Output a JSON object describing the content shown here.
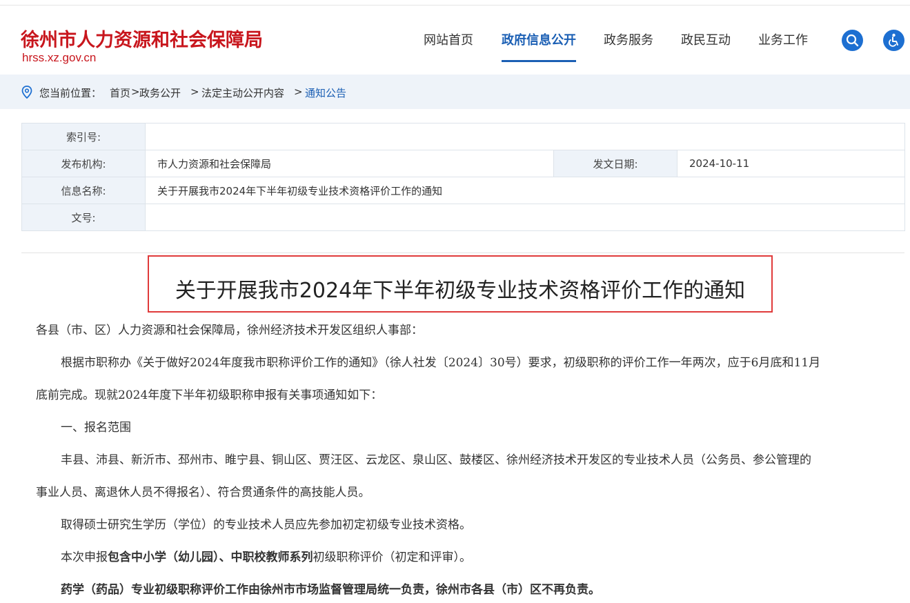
{
  "site": {
    "title": "徐州市人力资源和社会保障局",
    "url": "hrss.xz.gov.cn"
  },
  "nav": {
    "items": [
      {
        "label": "网站首页"
      },
      {
        "label": "政府信息公开",
        "active": true
      },
      {
        "label": "政务服务"
      },
      {
        "label": "政民互动"
      },
      {
        "label": "业务工作"
      }
    ],
    "search_icon": "search-icon",
    "accessibility_icon": "accessibility-icon"
  },
  "breadcrumb": {
    "prefix": "您当前位置：",
    "home": "首页",
    "sep1": ">",
    "level1": "政务公开",
    "sep2": ">",
    "level2": "法定主动公开内容",
    "sep3": ">",
    "current": "通知公告"
  },
  "info": {
    "index_label": "索引号:",
    "index_value": "",
    "publisher_label": "发布机构:",
    "publisher_value": "市人力资源和社会保障局",
    "date_label": "发文日期:",
    "date_value": "2024-10-11",
    "name_label": "信息名称:",
    "name_value": "关于开展我市2024年下半年初级专业技术资格评价工作的通知",
    "docno_label": "文号:",
    "docno_value": ""
  },
  "article": {
    "title": "关于开展我市2024年下半年初级专业技术资格评价工作的通知",
    "salutation": "各县（市、区）人力资源和社会保障局，徐州经济技术开发区组织人事部：",
    "p1_line1": "根据市职称办《关于做好2024年度我市职称评价工作的通知》（徐人社发〔2024〕30号）要求，初级职称的评价工作一年两次，应于6月底和11月",
    "p1_line2": "底前完成。现就2024年度下半年初级职称申报有关事项通知如下：",
    "section1": "一、报名范围",
    "p2_line1": "丰县、沛县、新沂市、邳州市、睢宁县、铜山区、贾汪区、云龙区、泉山区、鼓楼区、徐州经济技术开发区的专业技术人员（公务员、参公管理的",
    "p2_line2": "事业人员、离退休人员不得报名）、符合贯通条件的高技能人员。",
    "p3": "取得硕士研究生学历（学位）的专业技术人员应先参加初定初级专业技术资格。",
    "p4_pre": "本次申报",
    "p4_bold": "包含中小学（幼儿园）、中职校教师系列",
    "p4_post": "初级职称评价（初定和评审）。",
    "p5": "药学（药品）专业初级职称评价工作由徐州市市场监督管理局统一负责，徐州市各县（市）区不再负责。"
  },
  "colors": {
    "brand_red": "#c8161d",
    "nav_blue": "#1b5fb4",
    "highlight_border": "#e03a3a"
  }
}
